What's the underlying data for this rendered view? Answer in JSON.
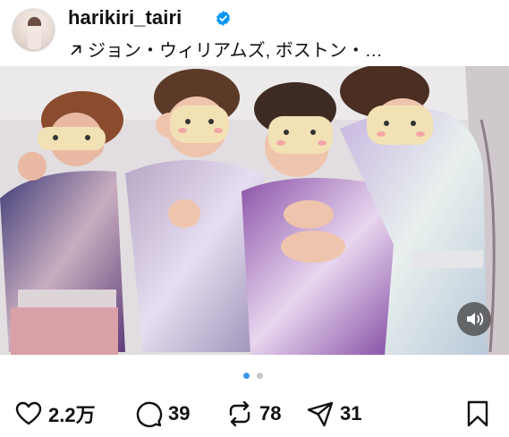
{
  "post": {
    "username": "harikiri_tairi",
    "location": "ジョン・ウィリアムズ, ボストン・…"
  },
  "carousel": {
    "active_index": 0,
    "total": 2,
    "active_color": "#3897f0",
    "inactive_color": "#c7c7c7"
  },
  "actions": {
    "likes": "2.2万",
    "comments": "39",
    "reposts": "78",
    "shares": "31"
  },
  "colors": {
    "verified": "#0095f6",
    "text": "#111111"
  },
  "icons": [
    "location-arrow-icon",
    "verified-badge-icon",
    "heart-icon",
    "comment-icon",
    "repost-icon",
    "share-icon",
    "bookmark-icon",
    "sound-on-icon"
  ]
}
